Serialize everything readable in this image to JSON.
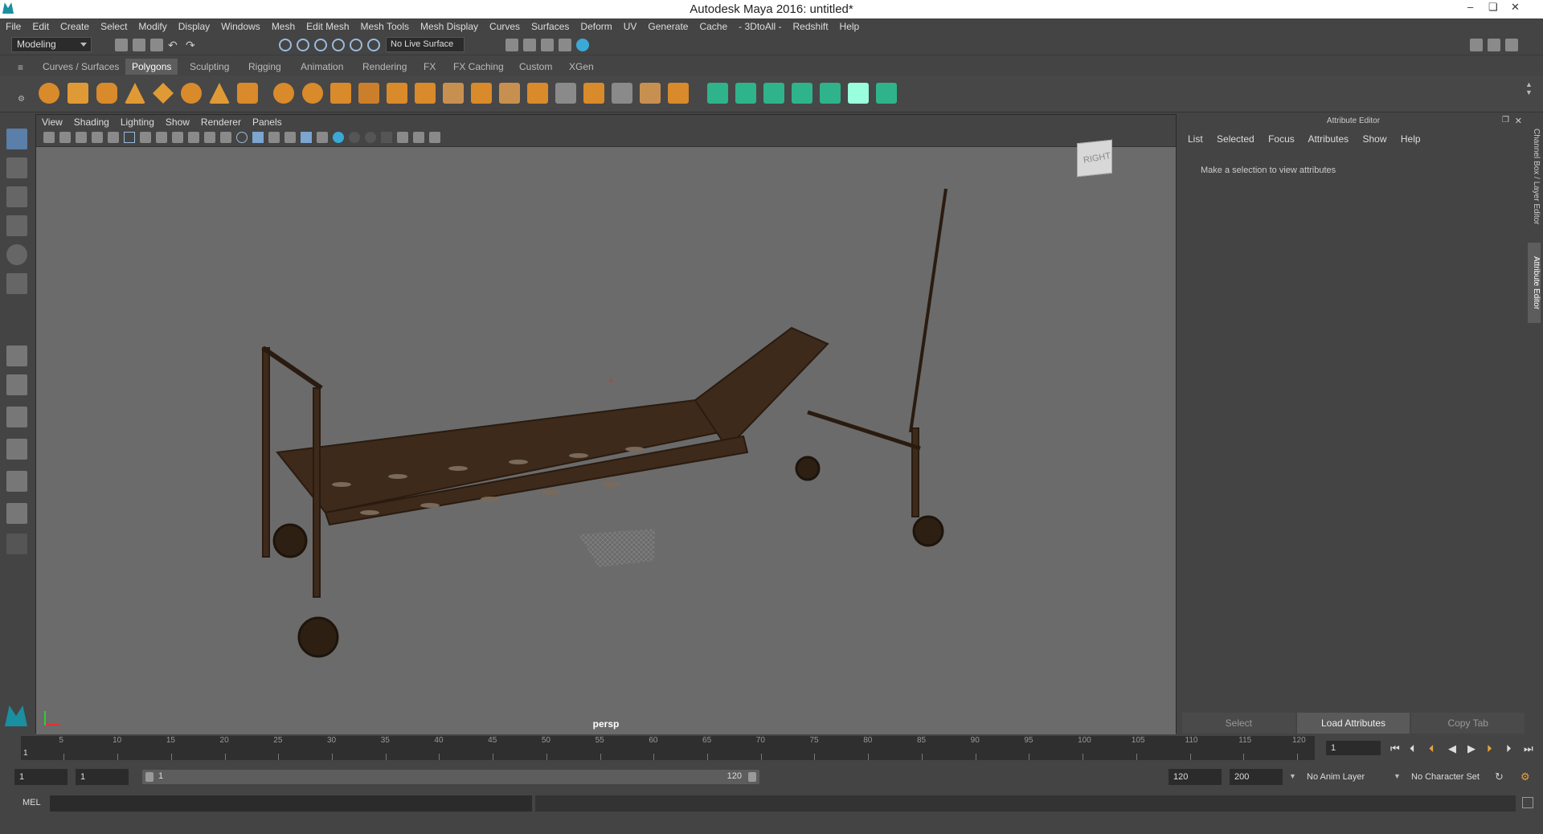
{
  "window": {
    "title": "Autodesk Maya 2016: untitled*"
  },
  "menubar": [
    "File",
    "Edit",
    "Create",
    "Select",
    "Modify",
    "Display",
    "Windows",
    "Mesh",
    "Edit Mesh",
    "Mesh Tools",
    "Mesh Display",
    "Curves",
    "Surfaces",
    "Deform",
    "UV",
    "Generate",
    "Cache",
    "- 3DtoAll -",
    "Redshift",
    "Help"
  ],
  "statusline": {
    "mode": "Modeling",
    "live_surface": "No Live Surface"
  },
  "shelf_tabs": [
    "Curves / Surfaces",
    "Polygons",
    "Sculpting",
    "Rigging",
    "Animation",
    "Rendering",
    "FX",
    "FX Caching",
    "Custom",
    "XGen"
  ],
  "shelf_active": "Polygons",
  "viewport": {
    "menu": [
      "View",
      "Shading",
      "Lighting",
      "Show",
      "Renderer",
      "Panels"
    ],
    "camera_label": "persp",
    "viewcube_label": "RIGHT"
  },
  "attribute_editor": {
    "header": "Attribute Editor",
    "menu": [
      "List",
      "Selected",
      "Focus",
      "Attributes",
      "Show",
      "Help"
    ],
    "message": "Make a selection to view attributes",
    "buttons": {
      "select": "Select",
      "load": "Load Attributes",
      "copy": "Copy Tab"
    }
  },
  "side_tabs": {
    "channel_box": "Channel Box / Layer Editor",
    "attribute_editor": "Attribute Editor"
  },
  "timeline": {
    "ticks": [
      "5",
      "10",
      "15",
      "20",
      "25",
      "30",
      "35",
      "40",
      "45",
      "50",
      "55",
      "60",
      "65",
      "70",
      "75",
      "80",
      "85",
      "90",
      "95",
      "100",
      "105",
      "110",
      "115",
      "120"
    ],
    "current_marker": "1",
    "current_frame": "1"
  },
  "range": {
    "start": "1",
    "playback_start": "1",
    "slider_start": "1",
    "slider_end": "120",
    "playback_end": "120",
    "end": "200",
    "anim_layer": "No Anim Layer",
    "character_set": "No Character Set"
  },
  "command_line": {
    "label": "MEL"
  },
  "colors": {
    "accent": "#5d5d5d",
    "viewport_bg": "#6b6b6b",
    "model": "#3e2a1a"
  }
}
